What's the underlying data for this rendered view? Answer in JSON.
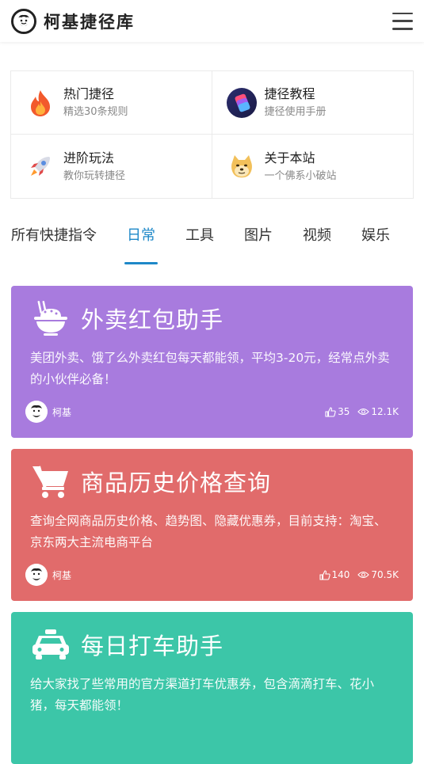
{
  "header": {
    "site_title": "柯基捷径库",
    "logo_icon": "corgi-face-logo",
    "menu_icon": "hamburger-menu-icon"
  },
  "quick_nav": [
    {
      "title": "热门捷径",
      "subtitle": "精选30条规则",
      "icon": "fire-icon"
    },
    {
      "title": "捷径教程",
      "subtitle": "捷径使用手册",
      "icon": "shortcuts-app-icon"
    },
    {
      "title": "进阶玩法",
      "subtitle": "教你玩转捷径",
      "icon": "rocket-icon"
    },
    {
      "title": "关于本站",
      "subtitle": "一个佛系小破站",
      "icon": "doge-icon"
    }
  ],
  "tabs": [
    {
      "label": "所有快捷指令",
      "active": false
    },
    {
      "label": "日常",
      "active": true
    },
    {
      "label": "工具",
      "active": false
    },
    {
      "label": "图片",
      "active": false
    },
    {
      "label": "视频",
      "active": false
    },
    {
      "label": "娱乐",
      "active": false
    }
  ],
  "cards": [
    {
      "title": "外卖红包助手",
      "description": "美团外卖、饿了么外卖红包每天都能领，平均3-20元，经常点外卖的小伙伴必备！",
      "author": "柯基",
      "likes": "35",
      "views": "12.1K",
      "icon": "rice-bowl-icon",
      "color": "#a87bde"
    },
    {
      "title": "商品历史价格查询",
      "description": "查询全网商品历史价格、趋势图、隐藏优惠券，目前支持：淘宝、京东两大主流电商平台",
      "author": "柯基",
      "likes": "140",
      "views": "70.5K",
      "icon": "shopping-cart-icon",
      "color": "#e16b6b"
    },
    {
      "title": "每日打车助手",
      "description": "给大家找了些常用的官方渠道打车优惠券，包含滴滴打车、花小猪，每天都能领！",
      "author": "",
      "likes": "",
      "views": "",
      "icon": "taxi-icon",
      "color": "#3cc6a8"
    }
  ],
  "colors": {
    "accent": "#1e88c8",
    "card_purple": "#a87bde",
    "card_red": "#e16b6b",
    "card_teal": "#3cc6a8"
  }
}
